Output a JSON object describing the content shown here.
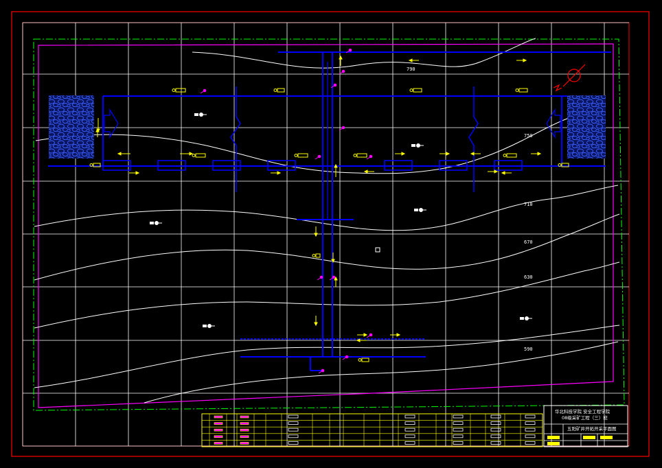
{
  "contours": [
    {
      "value": "790"
    },
    {
      "value": "750"
    },
    {
      "value": "710"
    },
    {
      "value": "670"
    },
    {
      "value": "630"
    },
    {
      "value": "590"
    }
  ],
  "title_block": {
    "school_line1": "华北科技学院 安全工程学院",
    "school_line2": "08级采矿工程（三）班",
    "drawing_title": "五阳矿井开拓开采平面图"
  },
  "colors": {
    "frame_red": "#ff0000",
    "boundary_green": "#00ff00",
    "boundary_magenta": "#ff00ff",
    "grid_white": "#ffffff",
    "roadway_blue": "#0000ff",
    "annotation_yellow": "#ffff00",
    "rock_fill": "#1a2a8a"
  },
  "icons": [
    "north-arrow-icon",
    "ventilation-arrow-icon",
    "fan-icon",
    "borehole-marker-icon"
  ]
}
